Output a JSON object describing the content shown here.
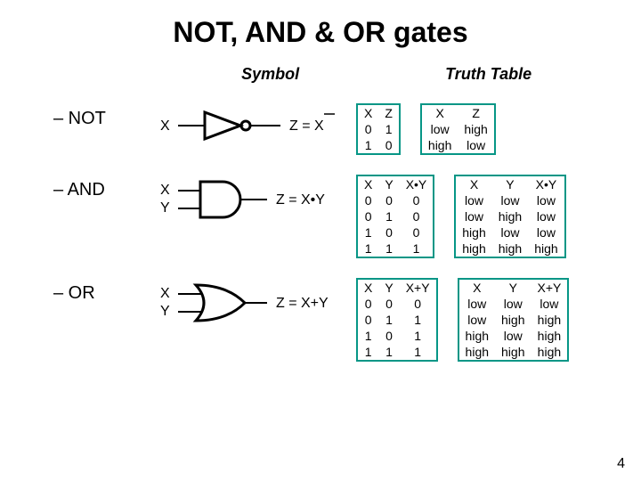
{
  "page": {
    "title": "NOT, AND & OR gates",
    "number": "4"
  },
  "col_headers": {
    "symbol": "Symbol",
    "truth": "Truth Table"
  },
  "gates": {
    "not": {
      "label": "– NOT",
      "sym_in": "X",
      "sym_out": "Z = X",
      "tt_num": {
        "h": [
          "X",
          "Z"
        ],
        "r": [
          [
            "0",
            "1"
          ],
          [
            "1",
            "0"
          ]
        ]
      },
      "tt_lev": {
        "h": [
          "X",
          "Z"
        ],
        "r": [
          [
            "low",
            "high"
          ],
          [
            "high",
            "low"
          ]
        ]
      }
    },
    "and": {
      "label": "– AND",
      "sym_in1": "X",
      "sym_in2": "Y",
      "sym_out": "Z = X•Y",
      "tt_num": {
        "h": [
          "X",
          "Y",
          "X•Y"
        ],
        "r": [
          [
            "0",
            "0",
            "0"
          ],
          [
            "0",
            "1",
            "0"
          ],
          [
            "1",
            "0",
            "0"
          ],
          [
            "1",
            "1",
            "1"
          ]
        ]
      },
      "tt_lev": {
        "h": [
          "X",
          "Y",
          "X•Y"
        ],
        "r": [
          [
            "low",
            "low",
            "low"
          ],
          [
            "low",
            "high",
            "low"
          ],
          [
            "high",
            "low",
            "low"
          ],
          [
            "high",
            "high",
            "high"
          ]
        ]
      }
    },
    "or": {
      "label": "– OR",
      "sym_in1": "X",
      "sym_in2": "Y",
      "sym_out": "Z = X+Y",
      "tt_num": {
        "h": [
          "X",
          "Y",
          "X+Y"
        ],
        "r": [
          [
            "0",
            "0",
            "0"
          ],
          [
            "0",
            "1",
            "1"
          ],
          [
            "1",
            "0",
            "1"
          ],
          [
            "1",
            "1",
            "1"
          ]
        ]
      },
      "tt_lev": {
        "h": [
          "X",
          "Y",
          "X+Y"
        ],
        "r": [
          [
            "low",
            "low",
            "low"
          ],
          [
            "low",
            "high",
            "high"
          ],
          [
            "high",
            "low",
            "high"
          ],
          [
            "high",
            "high",
            "high"
          ]
        ]
      }
    }
  }
}
